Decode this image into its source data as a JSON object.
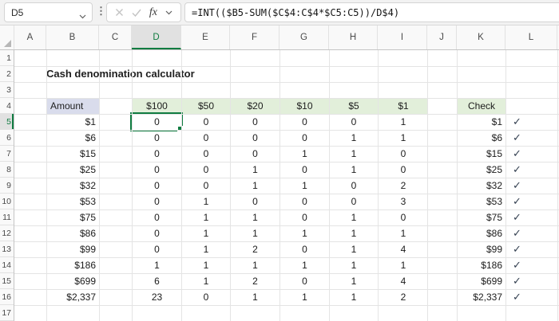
{
  "app": {
    "name_box": "D5",
    "formula": "=INT(($B5-SUM($C$4:C$4*$C5:C5))/D$4)",
    "fx_label": "fx"
  },
  "sheet": {
    "title": "Cash denomination calculator",
    "column_letters": [
      "A",
      "B",
      "C",
      "D",
      "E",
      "F",
      "G",
      "H",
      "I",
      "J",
      "K",
      "L"
    ],
    "row_numbers": [
      1,
      2,
      3,
      4,
      5,
      6,
      7,
      8,
      9,
      10,
      11,
      12,
      13,
      14,
      15,
      16,
      17
    ],
    "selected_cell": "D5",
    "selected_column": "D",
    "selected_row": 5
  },
  "table": {
    "amount_header": "Amount",
    "check_header": "Check",
    "check_symbol": "✓",
    "denominations": [
      "$100",
      "$50",
      "$20",
      "$10",
      "$5",
      "$1"
    ],
    "first_data_row": 5,
    "rows": [
      {
        "amount": "$1",
        "counts": [
          0,
          0,
          0,
          0,
          0,
          1
        ],
        "check": "$1",
        "ok": true
      },
      {
        "amount": "$6",
        "counts": [
          0,
          0,
          0,
          0,
          1,
          1
        ],
        "check": "$6",
        "ok": true
      },
      {
        "amount": "$15",
        "counts": [
          0,
          0,
          0,
          1,
          1,
          0
        ],
        "check": "$15",
        "ok": true
      },
      {
        "amount": "$25",
        "counts": [
          0,
          0,
          1,
          0,
          1,
          0
        ],
        "check": "$25",
        "ok": true
      },
      {
        "amount": "$32",
        "counts": [
          0,
          0,
          1,
          1,
          0,
          2
        ],
        "check": "$32",
        "ok": true
      },
      {
        "amount": "$53",
        "counts": [
          0,
          1,
          0,
          0,
          0,
          3
        ],
        "check": "$53",
        "ok": true
      },
      {
        "amount": "$75",
        "counts": [
          0,
          1,
          1,
          0,
          1,
          0
        ],
        "check": "$75",
        "ok": true
      },
      {
        "amount": "$86",
        "counts": [
          0,
          1,
          1,
          1,
          1,
          1
        ],
        "check": "$86",
        "ok": true
      },
      {
        "amount": "$99",
        "counts": [
          0,
          1,
          2,
          0,
          1,
          4
        ],
        "check": "$99",
        "ok": true
      },
      {
        "amount": "$186",
        "counts": [
          1,
          1,
          1,
          1,
          1,
          1
        ],
        "check": "$186",
        "ok": true
      },
      {
        "amount": "$699",
        "counts": [
          6,
          1,
          2,
          0,
          1,
          4
        ],
        "check": "$699",
        "ok": true
      },
      {
        "amount": "$2,337",
        "counts": [
          23,
          0,
          1,
          1,
          1,
          2
        ],
        "check": "$2,337",
        "ok": true
      }
    ]
  },
  "colors": {
    "selection_green": "#107C41",
    "denom_header_fill": "#E2EFDA",
    "amount_header_fill": "#D9DCEC",
    "check_mark_color": "#333F50"
  }
}
